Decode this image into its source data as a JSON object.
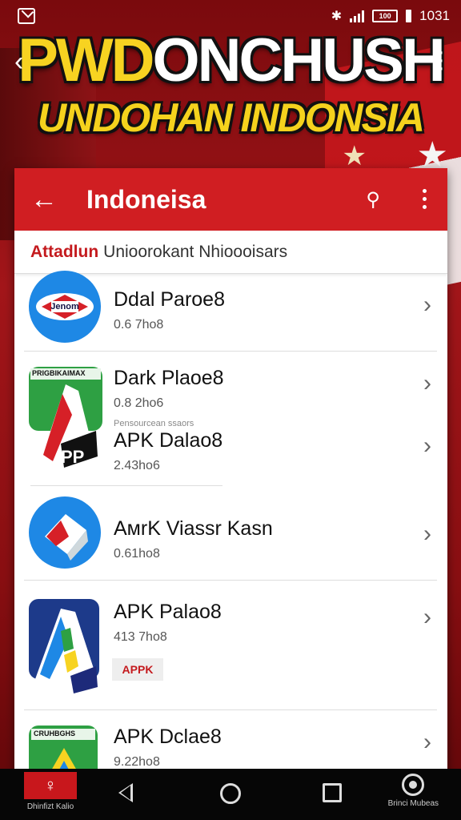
{
  "status_bar": {
    "time": "1031",
    "battery": "100"
  },
  "banner": {
    "title_highlight": "PWD",
    "title_rest": "ONCHUSH",
    "subtitle": "UNDOHAN INDONSIA"
  },
  "app_bar": {
    "title": "Indoneisa"
  },
  "sub_header": {
    "red_text": "Attadlun",
    "gray_text": "Unioorokant Nhioooisars"
  },
  "apps": [
    {
      "name": "Ddal  Paroe8",
      "meta": "0.6  7ho8"
    },
    {
      "name": "Dark  Plaoe8",
      "meta": "0.8  2ho6"
    },
    {
      "name": "APK  Dalao8",
      "meta": "2.43ho6",
      "caption": "Pensourcean  ssaors"
    },
    {
      "name": "AмrK  Viassr Kasn",
      "meta": "0.61ho8"
    },
    {
      "name": "APK  Palao8",
      "meta": "413  7ho8",
      "badge": "APPK"
    },
    {
      "name": "APK  Dclae8",
      "meta": "9.22ho8"
    }
  ],
  "icon_labels": {
    "icon1": "Jenom",
    "icon2_top": "PRIGBIKAIMAX",
    "icon2_bottom": "PP",
    "icon6_top": "CRUHBGHS"
  },
  "bottom_nav": {
    "left_label": "Dhinfizt Kalio",
    "right_label": "Brinci Mubeas"
  },
  "colors": {
    "accent": "#d01e22",
    "icon_blue": "#1e88e5",
    "banner_yellow": "#f7d321"
  }
}
